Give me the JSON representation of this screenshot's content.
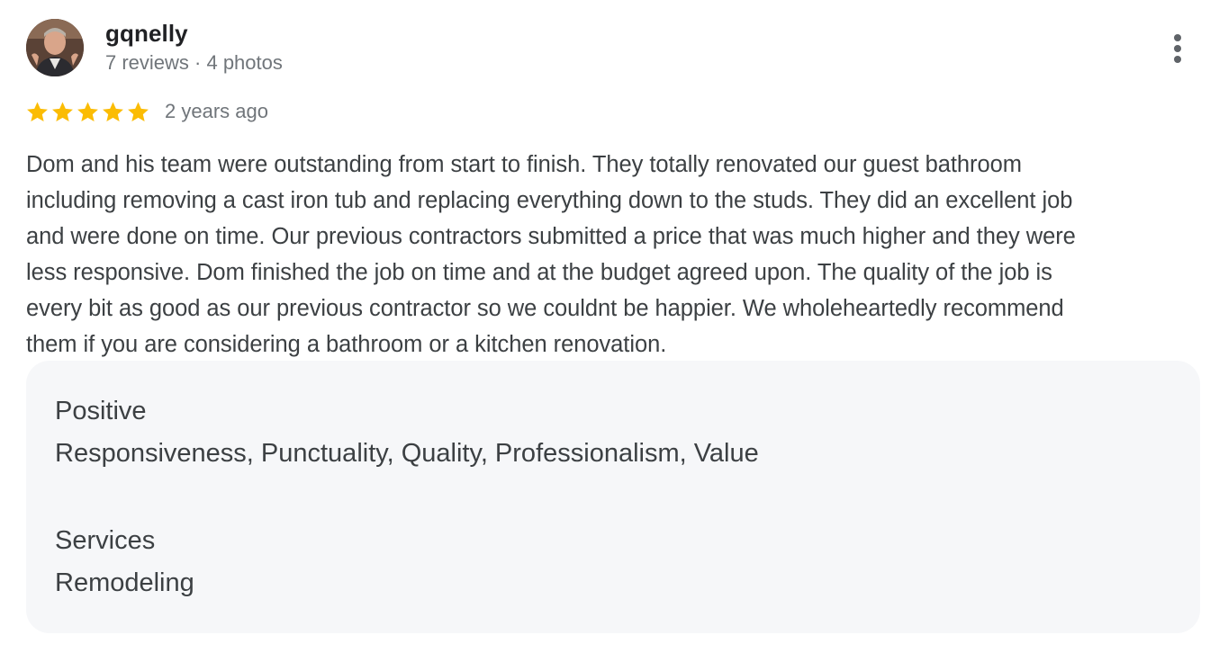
{
  "author": {
    "name": "gqnelly",
    "meta": "7 reviews · 4 photos",
    "avatar_icon": "profile-photo"
  },
  "menu": {
    "icon": "more-vert-icon"
  },
  "rating": {
    "stars": 5,
    "max_stars": 5,
    "star_color": "#fbbc04",
    "time": "2 years ago"
  },
  "review": {
    "text": "Dom and his team were outstanding from start to finish. They totally renovated our guest bathroom\nincluding removing a cast iron tub and replacing everything down to the studs. They did an excellent job\nand were done on time. Our previous contractors submitted a price that was much higher and they were\nless responsive. Dom finished the job on time and at the budget agreed upon. The quality of the job is\nevery bit as good as our previous contractor so we couldnt be happier. We wholeheartedly recommend\nthem if you are considering a bathroom or a kitchen renovation."
  },
  "attributes": [
    {
      "heading": "Positive",
      "value": "Responsiveness, Punctuality, Quality, Professionalism, Value"
    },
    {
      "heading": "Services",
      "value": "Remodeling"
    }
  ],
  "colors": {
    "attributes_background": "#f6f7f9",
    "secondary_text": "#70757a"
  }
}
